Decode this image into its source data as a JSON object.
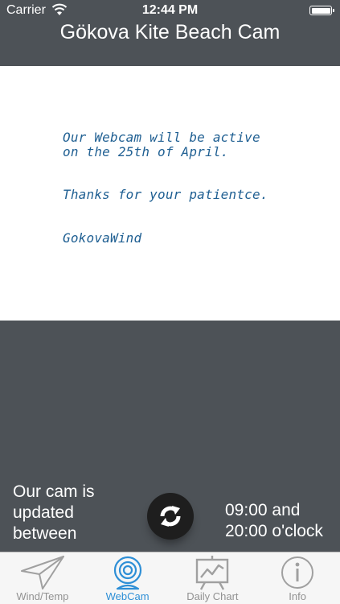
{
  "status_bar": {
    "carrier": "Carrier",
    "time": "12:44 PM"
  },
  "header": {
    "title": "Gökova Kite Beach Cam"
  },
  "webcam_image": {
    "lines": [
      "Our Webcam will be active",
      "on the 25th of April.",
      "Thanks for your patientce.",
      "GokovaWind"
    ]
  },
  "update_info": {
    "left_text": "Our cam is updated between",
    "right_line1": "09:00 and",
    "right_line2": "20:00 o'clock"
  },
  "tabs": [
    {
      "label": "Wind/Temp",
      "icon": "paper-plane-icon",
      "active": false
    },
    {
      "label": "WebCam",
      "icon": "webcam-icon",
      "active": true
    },
    {
      "label": "Daily Chart",
      "icon": "chart-board-icon",
      "active": false
    },
    {
      "label": "Info",
      "icon": "info-icon",
      "active": false
    }
  ],
  "colors": {
    "background": "#4d5257",
    "tab_active": "#2e8fd6",
    "tab_inactive": "#929292",
    "note_text": "#1f5f92"
  }
}
